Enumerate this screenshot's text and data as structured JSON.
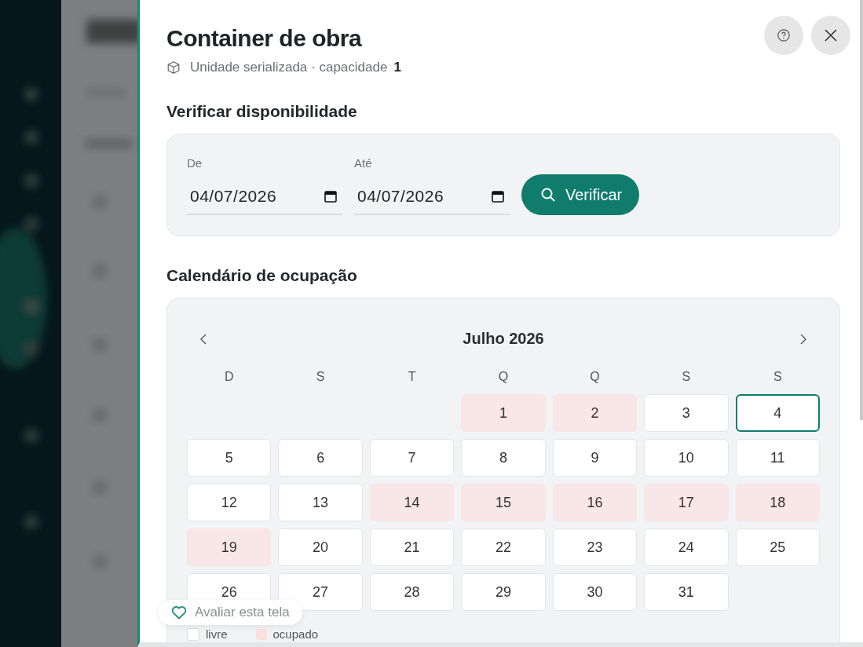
{
  "header": {
    "title": "Container de obra",
    "subtitle": "Unidade serializada · capacidade",
    "capacity": "1"
  },
  "availability": {
    "heading": "Verificar disponibilidade",
    "fields": [
      {
        "label": "De",
        "value": "04/07/2026"
      },
      {
        "label": "Até",
        "value": "04/07/2026"
      }
    ],
    "button": "Verificar"
  },
  "calendar": {
    "heading": "Calendário de ocupação",
    "month": "Julho 2026",
    "weekdays": [
      "D",
      "S",
      "T",
      "Q",
      "Q",
      "S",
      "S"
    ],
    "days": [
      {
        "kind": "empty"
      },
      {
        "kind": "empty"
      },
      {
        "kind": "empty"
      },
      {
        "kind": "day",
        "label": "1",
        "occupied": true,
        "selected": false
      },
      {
        "kind": "day",
        "label": "2",
        "occupied": true,
        "selected": false
      },
      {
        "kind": "day",
        "label": "3",
        "occupied": false,
        "selected": false
      },
      {
        "kind": "day",
        "label": "4",
        "occupied": false,
        "selected": true
      },
      {
        "kind": "day",
        "label": "5",
        "occupied": false,
        "selected": false
      },
      {
        "kind": "day",
        "label": "6",
        "occupied": false,
        "selected": false
      },
      {
        "kind": "day",
        "label": "7",
        "occupied": false,
        "selected": false
      },
      {
        "kind": "day",
        "label": "8",
        "occupied": false,
        "selected": false
      },
      {
        "kind": "day",
        "label": "9",
        "occupied": false,
        "selected": false
      },
      {
        "kind": "day",
        "label": "10",
        "occupied": false,
        "selected": false
      },
      {
        "kind": "day",
        "label": "11",
        "occupied": false,
        "selected": false
      },
      {
        "kind": "day",
        "label": "12",
        "occupied": false,
        "selected": false
      },
      {
        "kind": "day",
        "label": "13",
        "occupied": false,
        "selected": false
      },
      {
        "kind": "day",
        "label": "14",
        "occupied": true,
        "selected": false
      },
      {
        "kind": "day",
        "label": "15",
        "occupied": true,
        "selected": false
      },
      {
        "kind": "day",
        "label": "16",
        "occupied": true,
        "selected": false
      },
      {
        "kind": "day",
        "label": "17",
        "occupied": true,
        "selected": false
      },
      {
        "kind": "day",
        "label": "18",
        "occupied": true,
        "selected": false
      },
      {
        "kind": "day",
        "label": "19",
        "occupied": true,
        "selected": false
      },
      {
        "kind": "day",
        "label": "20",
        "occupied": false,
        "selected": false
      },
      {
        "kind": "day",
        "label": "21",
        "occupied": false,
        "selected": false
      },
      {
        "kind": "day",
        "label": "22",
        "occupied": false,
        "selected": false
      },
      {
        "kind": "day",
        "label": "23",
        "occupied": false,
        "selected": false
      },
      {
        "kind": "day",
        "label": "24",
        "occupied": false,
        "selected": false
      },
      {
        "kind": "day",
        "label": "25",
        "occupied": false,
        "selected": false
      },
      {
        "kind": "day",
        "label": "26",
        "occupied": false,
        "selected": false
      },
      {
        "kind": "day",
        "label": "27",
        "occupied": false,
        "selected": false
      },
      {
        "kind": "day",
        "label": "28",
        "occupied": false,
        "selected": false
      },
      {
        "kind": "day",
        "label": "29",
        "occupied": false,
        "selected": false
      },
      {
        "kind": "day",
        "label": "30",
        "occupied": false,
        "selected": false
      },
      {
        "kind": "day",
        "label": "31",
        "occupied": false,
        "selected": false
      }
    ]
  },
  "legend": [
    {
      "label": "livre",
      "kind": "free"
    },
    {
      "label": "ocupado",
      "kind": "occupied"
    }
  ],
  "feedback": {
    "label": "Avaliar esta tela"
  }
}
